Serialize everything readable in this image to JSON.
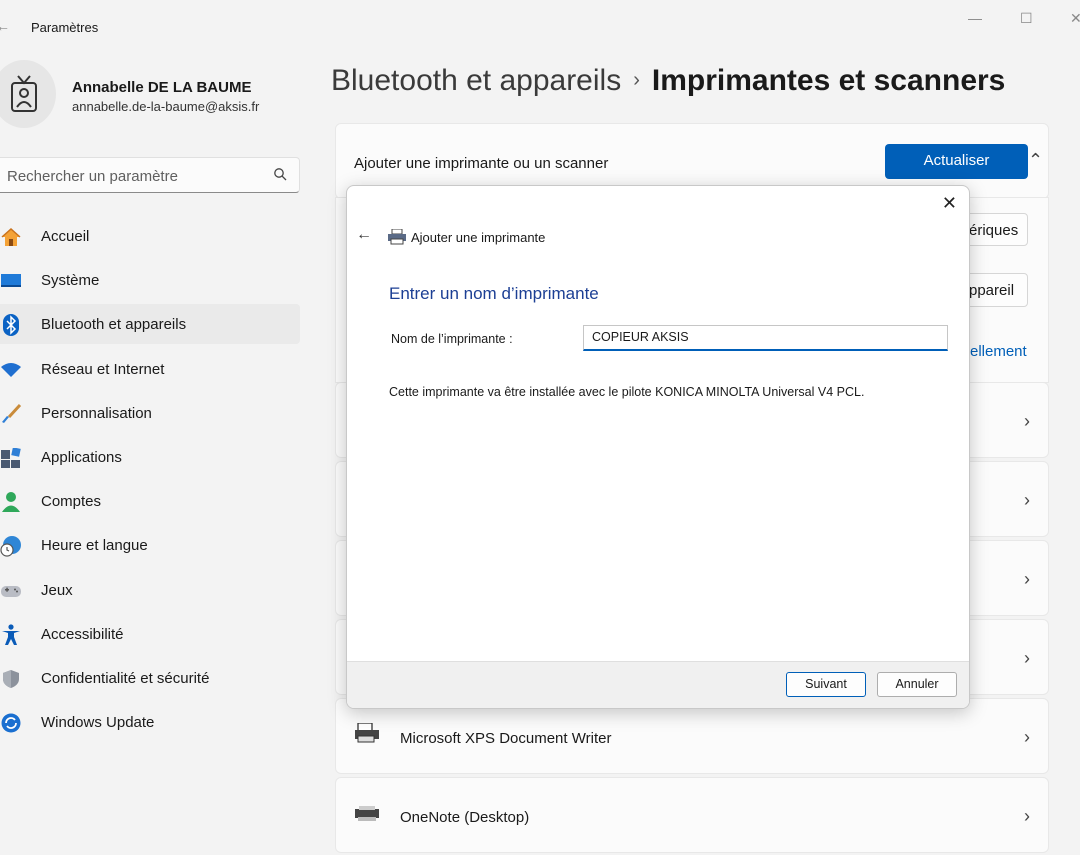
{
  "window": {
    "title": "Paramètres",
    "minimize": "—",
    "maximize": "☐",
    "close": "✕",
    "back": "←"
  },
  "user": {
    "name": "Annabelle DE LA BAUME",
    "email": "annabelle.de-la-baume@aksis.fr"
  },
  "search": {
    "placeholder": "Rechercher un paramètre"
  },
  "nav": [
    {
      "label": "Accueil",
      "icon": "home-icon"
    },
    {
      "label": "Système",
      "icon": "system-icon"
    },
    {
      "label": "Bluetooth et appareils",
      "icon": "bluetooth-icon",
      "active": true
    },
    {
      "label": "Réseau et Internet",
      "icon": "wifi-icon"
    },
    {
      "label": "Personnalisation",
      "icon": "brush-icon"
    },
    {
      "label": "Applications",
      "icon": "apps-icon"
    },
    {
      "label": "Comptes",
      "icon": "account-icon"
    },
    {
      "label": "Heure et langue",
      "icon": "time-language-icon"
    },
    {
      "label": "Jeux",
      "icon": "gamepad-icon"
    },
    {
      "label": "Accessibilité",
      "icon": "accessibility-icon"
    },
    {
      "label": "Confidentialité et sécurité",
      "icon": "shield-icon"
    },
    {
      "label": "Windows Update",
      "icon": "update-icon"
    }
  ],
  "breadcrumb": {
    "parent": "Bluetooth et appareils",
    "separator": "›",
    "current": "Imprimantes et scanners"
  },
  "main": {
    "add_device": {
      "label": "Ajouter une imprimante ou un scanner",
      "refresh_button": "Actualiser"
    },
    "partial": {
      "button_one": "ériques",
      "button_two": "ppareil",
      "link": "ellement"
    },
    "devices": [
      {
        "name": "Microsoft XPS Document Writer",
        "icon": "printer-icon"
      },
      {
        "name": "OneNote (Desktop)",
        "icon": "printer-icon"
      }
    ]
  },
  "dialog": {
    "title": "Ajouter une imprimante",
    "heading": "Entrer un nom d’imprimante",
    "field_label": "Nom de l’imprimante :",
    "field_value": "COPIEUR AKSIS",
    "description": "Cette imprimante va être installée avec le pilote KONICA MINOLTA Universal V4 PCL.",
    "next_button": "Suivant",
    "cancel_button": "Annuler",
    "close": "✕",
    "back": "←"
  },
  "colors": {
    "accent": "#005fb8",
    "heading_blue": "#1c3f94"
  }
}
